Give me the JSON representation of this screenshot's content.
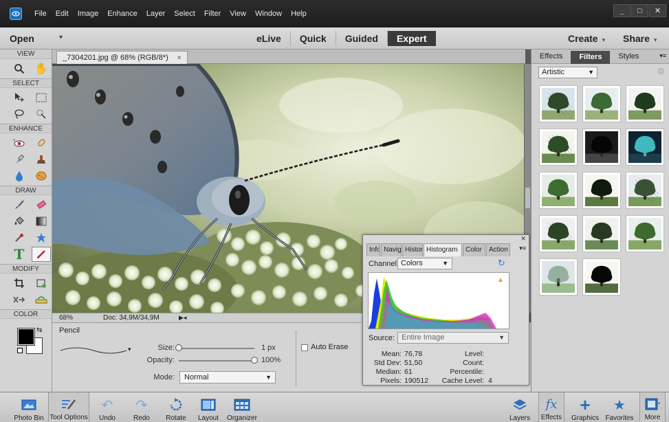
{
  "menu": {
    "items": [
      "File",
      "Edit",
      "Image",
      "Enhance",
      "Layer",
      "Select",
      "Filter",
      "View",
      "Window",
      "Help"
    ],
    "window_controls": [
      "_",
      "□",
      "✕"
    ]
  },
  "modebar": {
    "open": "Open",
    "tabs": [
      "eLive",
      "Quick",
      "Guided",
      "Expert"
    ],
    "active_tab": "Expert",
    "create": "Create",
    "share": "Share"
  },
  "toolbox": {
    "sections": [
      "VIEW",
      "SELECT",
      "ENHANCE",
      "DRAW",
      "MODIFY",
      "COLOR"
    ]
  },
  "document": {
    "tab_title": "_7304201.jpg @ 68% (RGB/8*)",
    "tab_close": "×",
    "zoom": "68%",
    "doc_size": "Doc: 34,9M/34,9M"
  },
  "tool_options": {
    "tool_name": "Pencil",
    "size_label": "Size:",
    "size_value": "1 px",
    "size_fraction": 0.0,
    "opacity_label": "Opacity:",
    "opacity_value": "100%",
    "opacity_fraction": 1.0,
    "mode_label": "Mode:",
    "mode_value": "Normal",
    "auto_erase_label": "Auto Erase"
  },
  "histogram_panel": {
    "tabs": [
      "Info",
      "Navig",
      "Histor",
      "Histogram",
      "Color",
      "Action"
    ],
    "active_tab": "Histogram",
    "channel_label": "Channel:",
    "channel_value": "Colors",
    "source_label": "Source:",
    "source_value": "Entire Image",
    "stats_left": [
      {
        "label": "Mean:",
        "value": "76,78"
      },
      {
        "label": "Std Dev:",
        "value": "51,50"
      },
      {
        "label": "Median:",
        "value": "61"
      },
      {
        "label": "Pixels:",
        "value": "190512"
      }
    ],
    "stats_right": [
      {
        "label": "Level:",
        "value": ""
      },
      {
        "label": "Count:",
        "value": ""
      },
      {
        "label": "Percentile:",
        "value": ""
      },
      {
        "label": "Cache Level:",
        "value": "4"
      }
    ]
  },
  "right_panel": {
    "tabs": [
      "Effects",
      "Filters",
      "Styles"
    ],
    "active_tab": "Filters",
    "category": "Artistic",
    "thumb_count": 14
  },
  "bottombar": {
    "left": [
      "Photo Bin",
      "Tool Options",
      "Undo",
      "Redo",
      "Rotate",
      "Layout",
      "Organizer"
    ],
    "right": [
      "Layers",
      "Effects",
      "Graphics",
      "Favorites",
      "More"
    ]
  }
}
